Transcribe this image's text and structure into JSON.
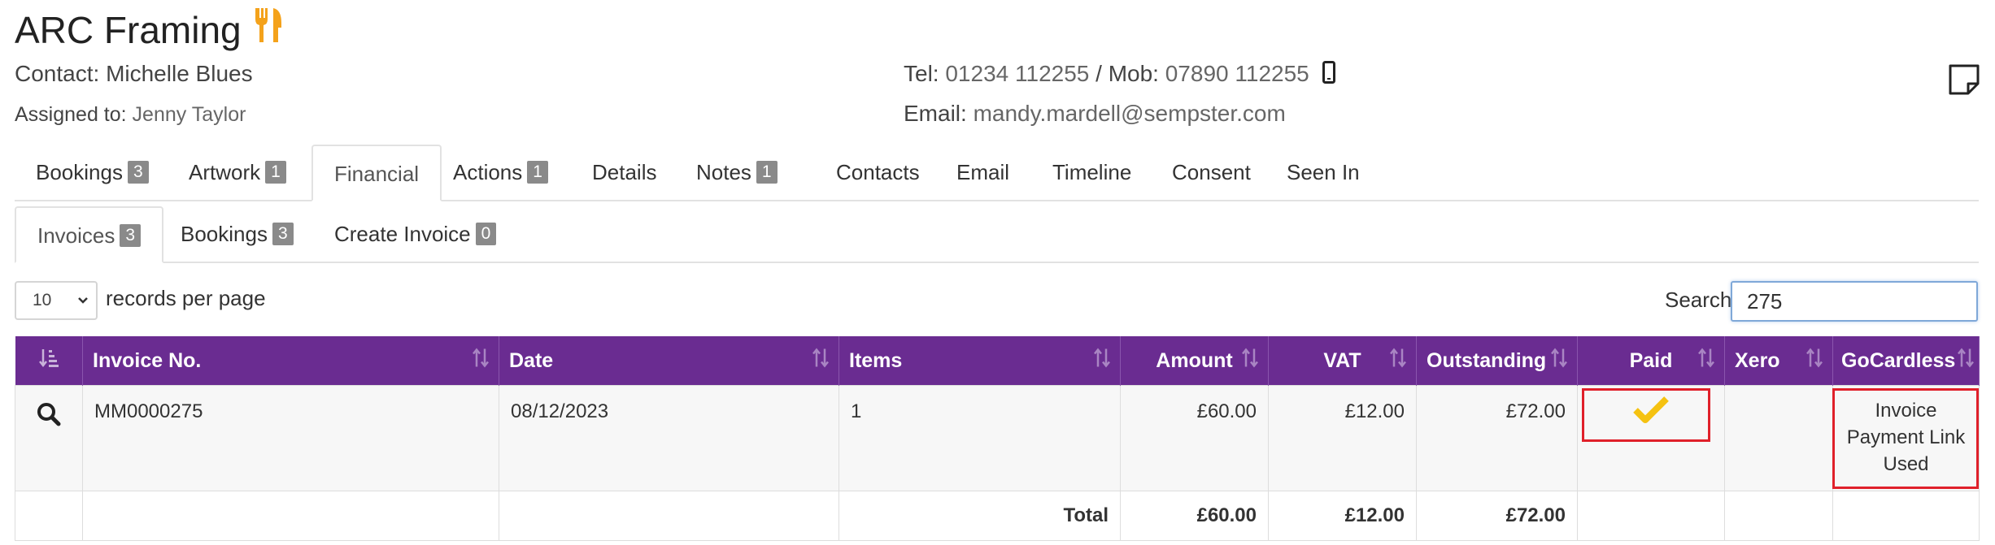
{
  "header": {
    "company": "ARC Framing",
    "contact_label": "Contact:",
    "contact_name": "Michelle Blues",
    "assigned_label": "Assigned to:",
    "assigned_name": "Jenny Taylor",
    "tel_label": "Tel:",
    "tel": "01234 112255",
    "mob_sep": " / Mob: ",
    "mob": "07890 112255",
    "email_label": "Email:",
    "email": "mandy.mardell@sempster.com",
    "accent_color": "#f4a21b"
  },
  "tabs": [
    {
      "label": "Bookings",
      "badge": "3"
    },
    {
      "label": "Artwork",
      "badge": "1"
    },
    {
      "label": "Financial",
      "badge": ""
    },
    {
      "label": "Actions",
      "badge": "1"
    },
    {
      "label": "Details",
      "badge": ""
    },
    {
      "label": "Notes",
      "badge": "1"
    },
    {
      "label": "Contacts",
      "badge": ""
    },
    {
      "label": "Email",
      "badge": ""
    },
    {
      "label": "Timeline",
      "badge": ""
    },
    {
      "label": "Consent",
      "badge": ""
    },
    {
      "label": "Seen In",
      "badge": ""
    }
  ],
  "subtabs": [
    {
      "label": "Invoices",
      "badge": "3"
    },
    {
      "label": "Bookings",
      "badge": "3"
    },
    {
      "label": "Create Invoice",
      "badge": "0"
    }
  ],
  "controls": {
    "page_size": "10",
    "records_per_page": "records per page",
    "search_label": "Search:",
    "search_value": "275"
  },
  "table": {
    "header_color": "#6a2c91",
    "columns": [
      "",
      "Invoice No.",
      "Date",
      "Items",
      "Amount",
      "VAT",
      "Outstanding",
      "Paid",
      "Xero",
      "GoCardless"
    ],
    "rows": [
      {
        "invoice_no": "MM0000275",
        "date": "08/12/2023",
        "items": "1",
        "amount": "£60.00",
        "vat": "£12.00",
        "outstanding": "£72.00",
        "paid": true,
        "xero": "",
        "gocardless": [
          "Invoice",
          "Payment Link",
          "Used"
        ]
      }
    ],
    "totals": {
      "label": "Total",
      "amount": "£60.00",
      "vat": "£12.00",
      "outstanding": "£72.00"
    }
  },
  "colors": {
    "check": "#f5c211",
    "highlight": "#e0202a"
  }
}
